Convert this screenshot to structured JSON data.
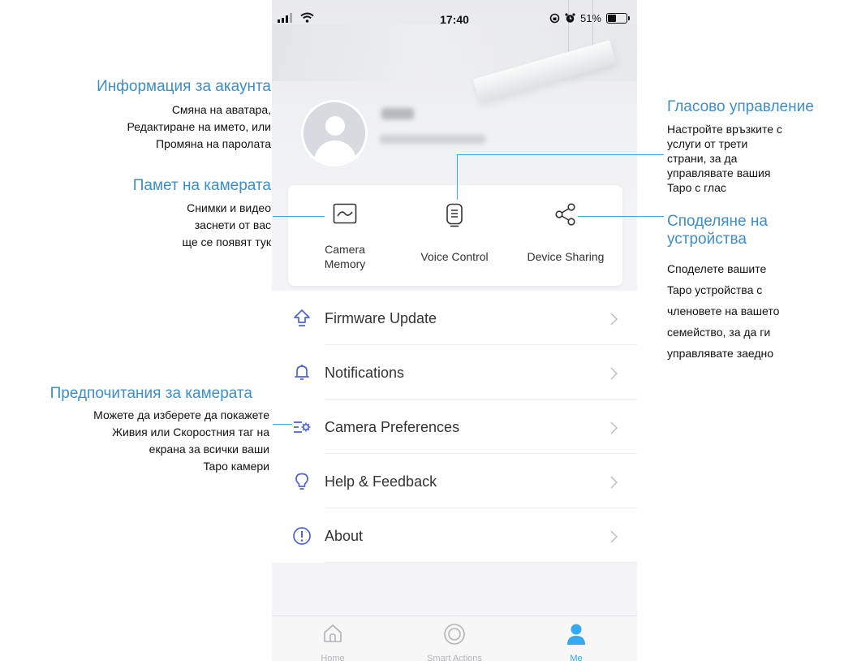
{
  "status_bar": {
    "time": "17:40",
    "battery": "51%",
    "battery_level": 0.51
  },
  "annotations": {
    "account": {
      "title": "Информация за акаунта",
      "lines": [
        "Смяна на аватара,",
        "Редактиране на името, или",
        "Промяна на паролата"
      ]
    },
    "camera_memory": {
      "title": "Памет на камерата",
      "lines": [
        "Снимки и видео",
        "заснети от вас",
        "ще се появят тук"
      ]
    },
    "camera_preferences": {
      "title": "Предпочитания за камерата",
      "lines": [
        "Можете да изберете да покажете",
        "Живия или Скоростния таг на",
        "екрана за всички ваши",
        "Tapo камери"
      ]
    },
    "voice_control": {
      "title": "Гласово управление",
      "lines": [
        "Настройте връзките с",
        "услуги от трети",
        "страни, за да",
        "управлявате вашия",
        "Tapo с глас"
      ]
    },
    "device_sharing": {
      "title_lines": [
        "Споделяне на",
        "устройства"
      ],
      "lines": [
        "Споделете вашите",
        "Tapo устройства с",
        "членовете на вашето",
        "семейство, за да ги",
        "управлявате заедно"
      ]
    }
  },
  "quick_actions": [
    {
      "label_line1": "Camera",
      "label_line2": "Memory",
      "icon": "camera-memory-icon"
    },
    {
      "label": "Voice Control",
      "icon": "voice-control-icon"
    },
    {
      "label": "Device Sharing",
      "icon": "share-icon"
    }
  ],
  "menu": [
    {
      "label": "Firmware Update",
      "icon": "firmware-update-icon"
    },
    {
      "label": "Notifications",
      "icon": "bell-icon"
    },
    {
      "label": "Camera Preferences",
      "icon": "camera-preferences-icon"
    },
    {
      "label": "Help & Feedback",
      "icon": "lightbulb-icon"
    },
    {
      "label": "About",
      "icon": "info-icon"
    }
  ],
  "tabs": [
    {
      "label": "Home",
      "icon": "home-icon",
      "active": false
    },
    {
      "label": "Smart Actions",
      "icon": "smart-actions-icon",
      "active": false
    },
    {
      "label": "Me",
      "icon": "person-icon",
      "active": true
    }
  ],
  "colors": {
    "accent": "#35a8ef",
    "annotation_title": "#3e8ec9",
    "leader_line": "#3aaed8",
    "menu_icon": "#4a63d6"
  }
}
